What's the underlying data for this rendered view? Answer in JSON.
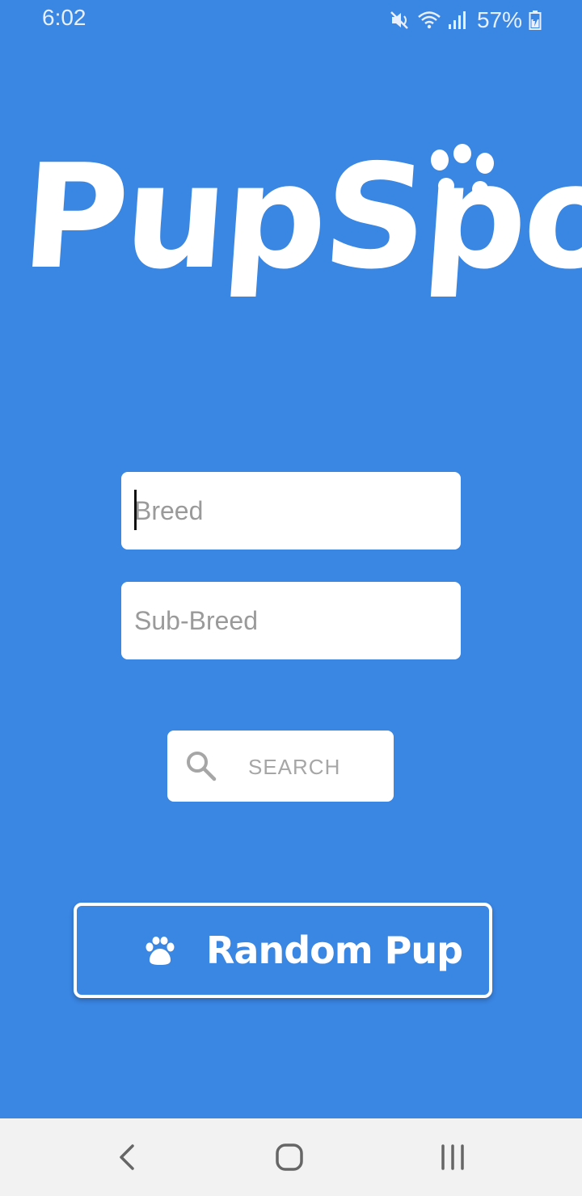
{
  "status_bar": {
    "time": "6:02",
    "battery_percent": "57%",
    "icons": [
      "mute-icon",
      "wifi-icon",
      "signal-icon",
      "battery-icon"
    ]
  },
  "logo": {
    "text": "PupSpot"
  },
  "form": {
    "breed_placeholder": "Breed",
    "breed_value": "",
    "subbreed_placeholder": "Sub-Breed",
    "subbreed_value": ""
  },
  "search_button": {
    "label": "SEARCH",
    "icon": "search-icon"
  },
  "random_button": {
    "label": "Random Pup",
    "icon": "paw-icon"
  },
  "nav_bar": {
    "buttons": [
      "back-icon",
      "home-icon",
      "recent-apps-icon"
    ]
  },
  "colors": {
    "background": "#3a86e3",
    "button_text_muted": "#a6a6a6",
    "nav_bar": "#f2f2f2"
  }
}
